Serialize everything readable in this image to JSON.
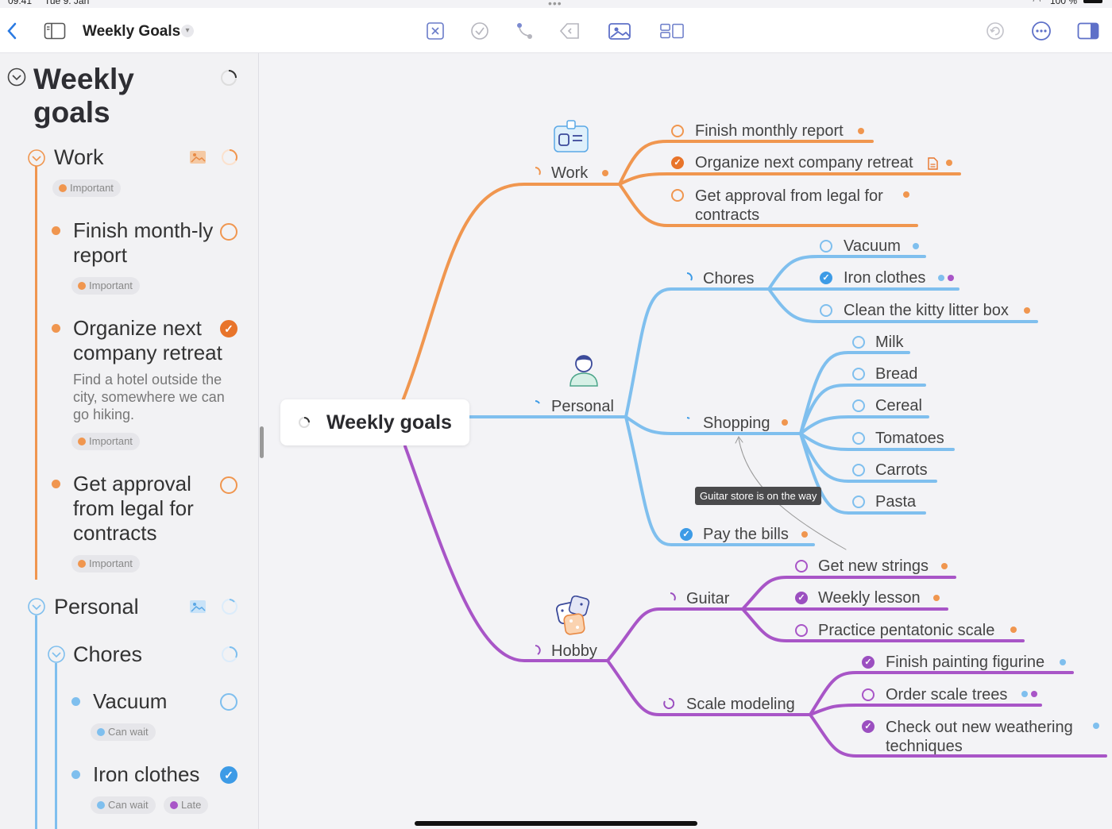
{
  "status": {
    "time": "09:41",
    "date": "Tue 9. Jan",
    "battery": "100 %"
  },
  "toolbar": {
    "title": "Weekly Goals"
  },
  "colors": {
    "work": "#f0964f",
    "personal": "#7fbfee",
    "hobby": "#a855c7",
    "checked_work": "#e8742a",
    "checked_personal": "#3d9be6",
    "checked_hobby": "#9b4fc0"
  },
  "sidebar": {
    "title": "Weekly goals",
    "work": {
      "label": "Work",
      "tag": "Important",
      "items": [
        {
          "label": "Finish month-ly report",
          "tag": "Important"
        },
        {
          "label": "Organize next company retreat",
          "note": "Find a hotel outside the city, somewhere we can go hiking.",
          "tag": "Important"
        },
        {
          "label": "Get approval from legal for contracts",
          "tag": "Important"
        }
      ]
    },
    "personal": {
      "label": "Personal",
      "chores": {
        "label": "Chores",
        "items": [
          {
            "label": "Vacuum",
            "tags": [
              "Can wait"
            ]
          },
          {
            "label": "Iron clothes",
            "tags": [
              "Can wait",
              "Late"
            ]
          }
        ]
      }
    }
  },
  "map": {
    "root": "Weekly goals",
    "work": {
      "label": "Work",
      "items": [
        "Finish monthly report",
        "Organize next company retreat",
        "Get approval from legal for contracts"
      ]
    },
    "personal": {
      "label": "Personal",
      "chores": {
        "label": "Chores",
        "items": [
          "Vacuum",
          "Iron clothes",
          "Clean the kitty litter box"
        ]
      },
      "shopping": {
        "label": "Shopping",
        "items": [
          "Milk",
          "Bread",
          "Cereal",
          "Tomatoes",
          "Carrots",
          "Pasta"
        ]
      },
      "bills": "Pay the bills"
    },
    "hobby": {
      "label": "Hobby",
      "guitar": {
        "label": "Guitar",
        "items": [
          "Get new strings",
          "Weekly lesson",
          "Practice pentatonic scale"
        ]
      },
      "scale": {
        "label": "Scale modeling",
        "items": [
          "Finish painting figurine",
          "Order scale trees",
          "Check out new weathering techniques"
        ]
      }
    },
    "tooltip": "Guitar store is on the way"
  }
}
